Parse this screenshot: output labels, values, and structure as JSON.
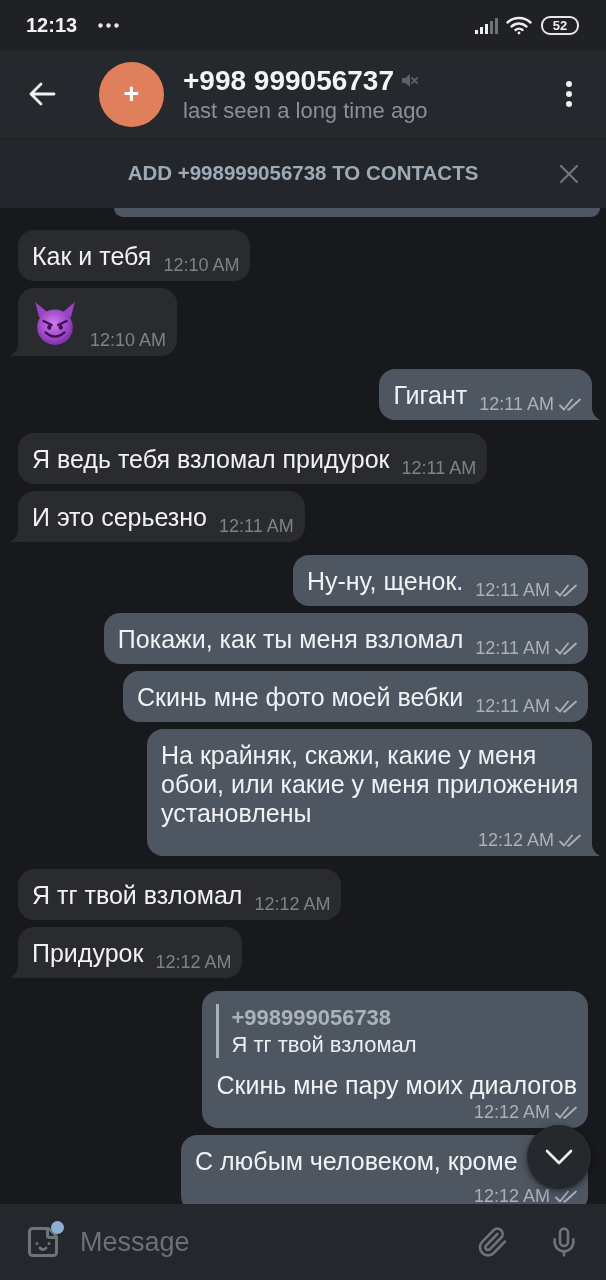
{
  "status_bar": {
    "time": "12:13",
    "battery": "52"
  },
  "header": {
    "avatar_initial": "+",
    "title": "+998 999056737",
    "muted": true,
    "subtitle": "last seen a long time ago"
  },
  "add_contact_bar": {
    "label": "ADD +998999056738 TO CONTACTS"
  },
  "messages": [
    {
      "kind": "clipped",
      "outgoing": true
    },
    {
      "kind": "text",
      "outgoing": false,
      "text": "Как и тебя",
      "time": "12:10 AM"
    },
    {
      "kind": "emoji",
      "outgoing": false,
      "time": "12:10 AM"
    },
    {
      "kind": "text",
      "outgoing": true,
      "text": "Гигант",
      "time": "12:11 AM",
      "read": true
    },
    {
      "kind": "text",
      "outgoing": false,
      "text": "Я ведь тебя взломал придурок",
      "time": "12:11 AM"
    },
    {
      "kind": "text",
      "outgoing": false,
      "text": "И это серьезно",
      "time": "12:11 AM"
    },
    {
      "kind": "text",
      "outgoing": true,
      "text": "Ну-ну, щенок.",
      "time": "12:11 AM",
      "read": true
    },
    {
      "kind": "text",
      "outgoing": true,
      "text": "Покажи, как ты меня взломал",
      "time": "12:11 AM",
      "read": true
    },
    {
      "kind": "text",
      "outgoing": true,
      "text": "Скинь мне фото моей вебки",
      "time": "12:11 AM",
      "read": true
    },
    {
      "kind": "text",
      "outgoing": true,
      "text": "На крайняк, скажи, какие у меня обои, или какие у меня приложения установлены",
      "time": "12:12 AM",
      "read": true
    },
    {
      "kind": "text",
      "outgoing": false,
      "text": "Я тг твой взломал",
      "time": "12:12 AM"
    },
    {
      "kind": "text",
      "outgoing": false,
      "text": "Придурок",
      "time": "12:12 AM"
    },
    {
      "kind": "reply",
      "outgoing": true,
      "reply_to": {
        "author": "+998999056738",
        "text": "Я тг твой взломал"
      },
      "text": "Скинь мне пару моих диалогов",
      "time": "12:12 AM",
      "read": true
    },
    {
      "kind": "cut",
      "outgoing": true,
      "text": "С любым человеком, кроме",
      "time": "12:12 AM",
      "read": true
    }
  ],
  "composer": {
    "placeholder": "Message",
    "sticker_badge": true
  }
}
